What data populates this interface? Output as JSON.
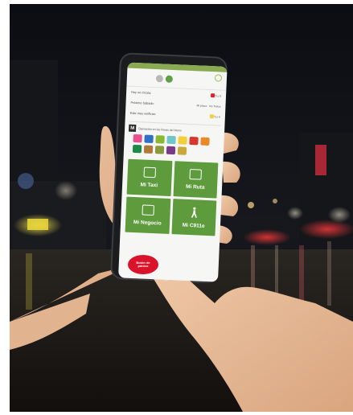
{
  "app": {
    "rows": [
      {
        "label": "Hoy no circula:",
        "value": "5 y 6",
        "color": "#e0212f"
      },
      {
        "label": "Próximo Sábado:",
        "value": "Mi placa · No Todos",
        "color": "#4a4a4a"
      },
      {
        "label": "Este mes verifican:",
        "value": "5 y 6",
        "color": "#f0d23c"
      }
    ],
    "metro": {
      "logo": "M",
      "title": "Operación en las líneas del Metro"
    },
    "services": [
      {
        "label": "Mi Taxi",
        "icon": "taxi-icon"
      },
      {
        "label": "Mi Ruta",
        "icon": "bus-icon"
      },
      {
        "label": "Mi Negocio",
        "icon": "briefcase-icon"
      },
      {
        "label": "Mi C911e",
        "icon": "person-walking-icon"
      }
    ],
    "panic_button": "Botón de pánico"
  },
  "colors": {
    "brand_green": "#5e9b3d",
    "panic_red": "#d8132a"
  }
}
